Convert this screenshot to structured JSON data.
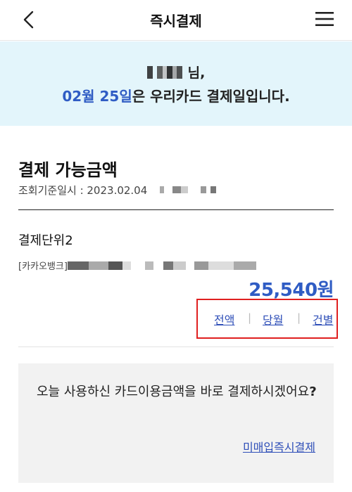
{
  "header": {
    "title": "즉시결제",
    "back_icon": "chevron-left-icon",
    "menu_icon": "hamburger-menu-icon"
  },
  "banner": {
    "name_suffix": "님,",
    "date_text": "02월 25일",
    "rest_text": "은 우리카드 결제일입니다."
  },
  "payable": {
    "title": "결제 가능금액",
    "as_of_label": "조회기준일시 : 2023.02.04"
  },
  "payment_unit": {
    "title": "결제단위2",
    "account_prefix": "[카카오뱅크]",
    "amount": "25,540원"
  },
  "filters": {
    "all": "전액",
    "month": "당월",
    "item": "건별",
    "separator": "|"
  },
  "notice": {
    "message": "오늘 사용하신 카드이용금액을 바로 결제하시겠어요",
    "question_mark": "?",
    "link": "미매입즉시결제"
  },
  "colors": {
    "accent": "#2f5cc4",
    "link": "#2f4fb8",
    "banner_bg": "#e3f5fb",
    "highlight_border": "#e02020",
    "notice_bg": "#f2f2f2"
  }
}
